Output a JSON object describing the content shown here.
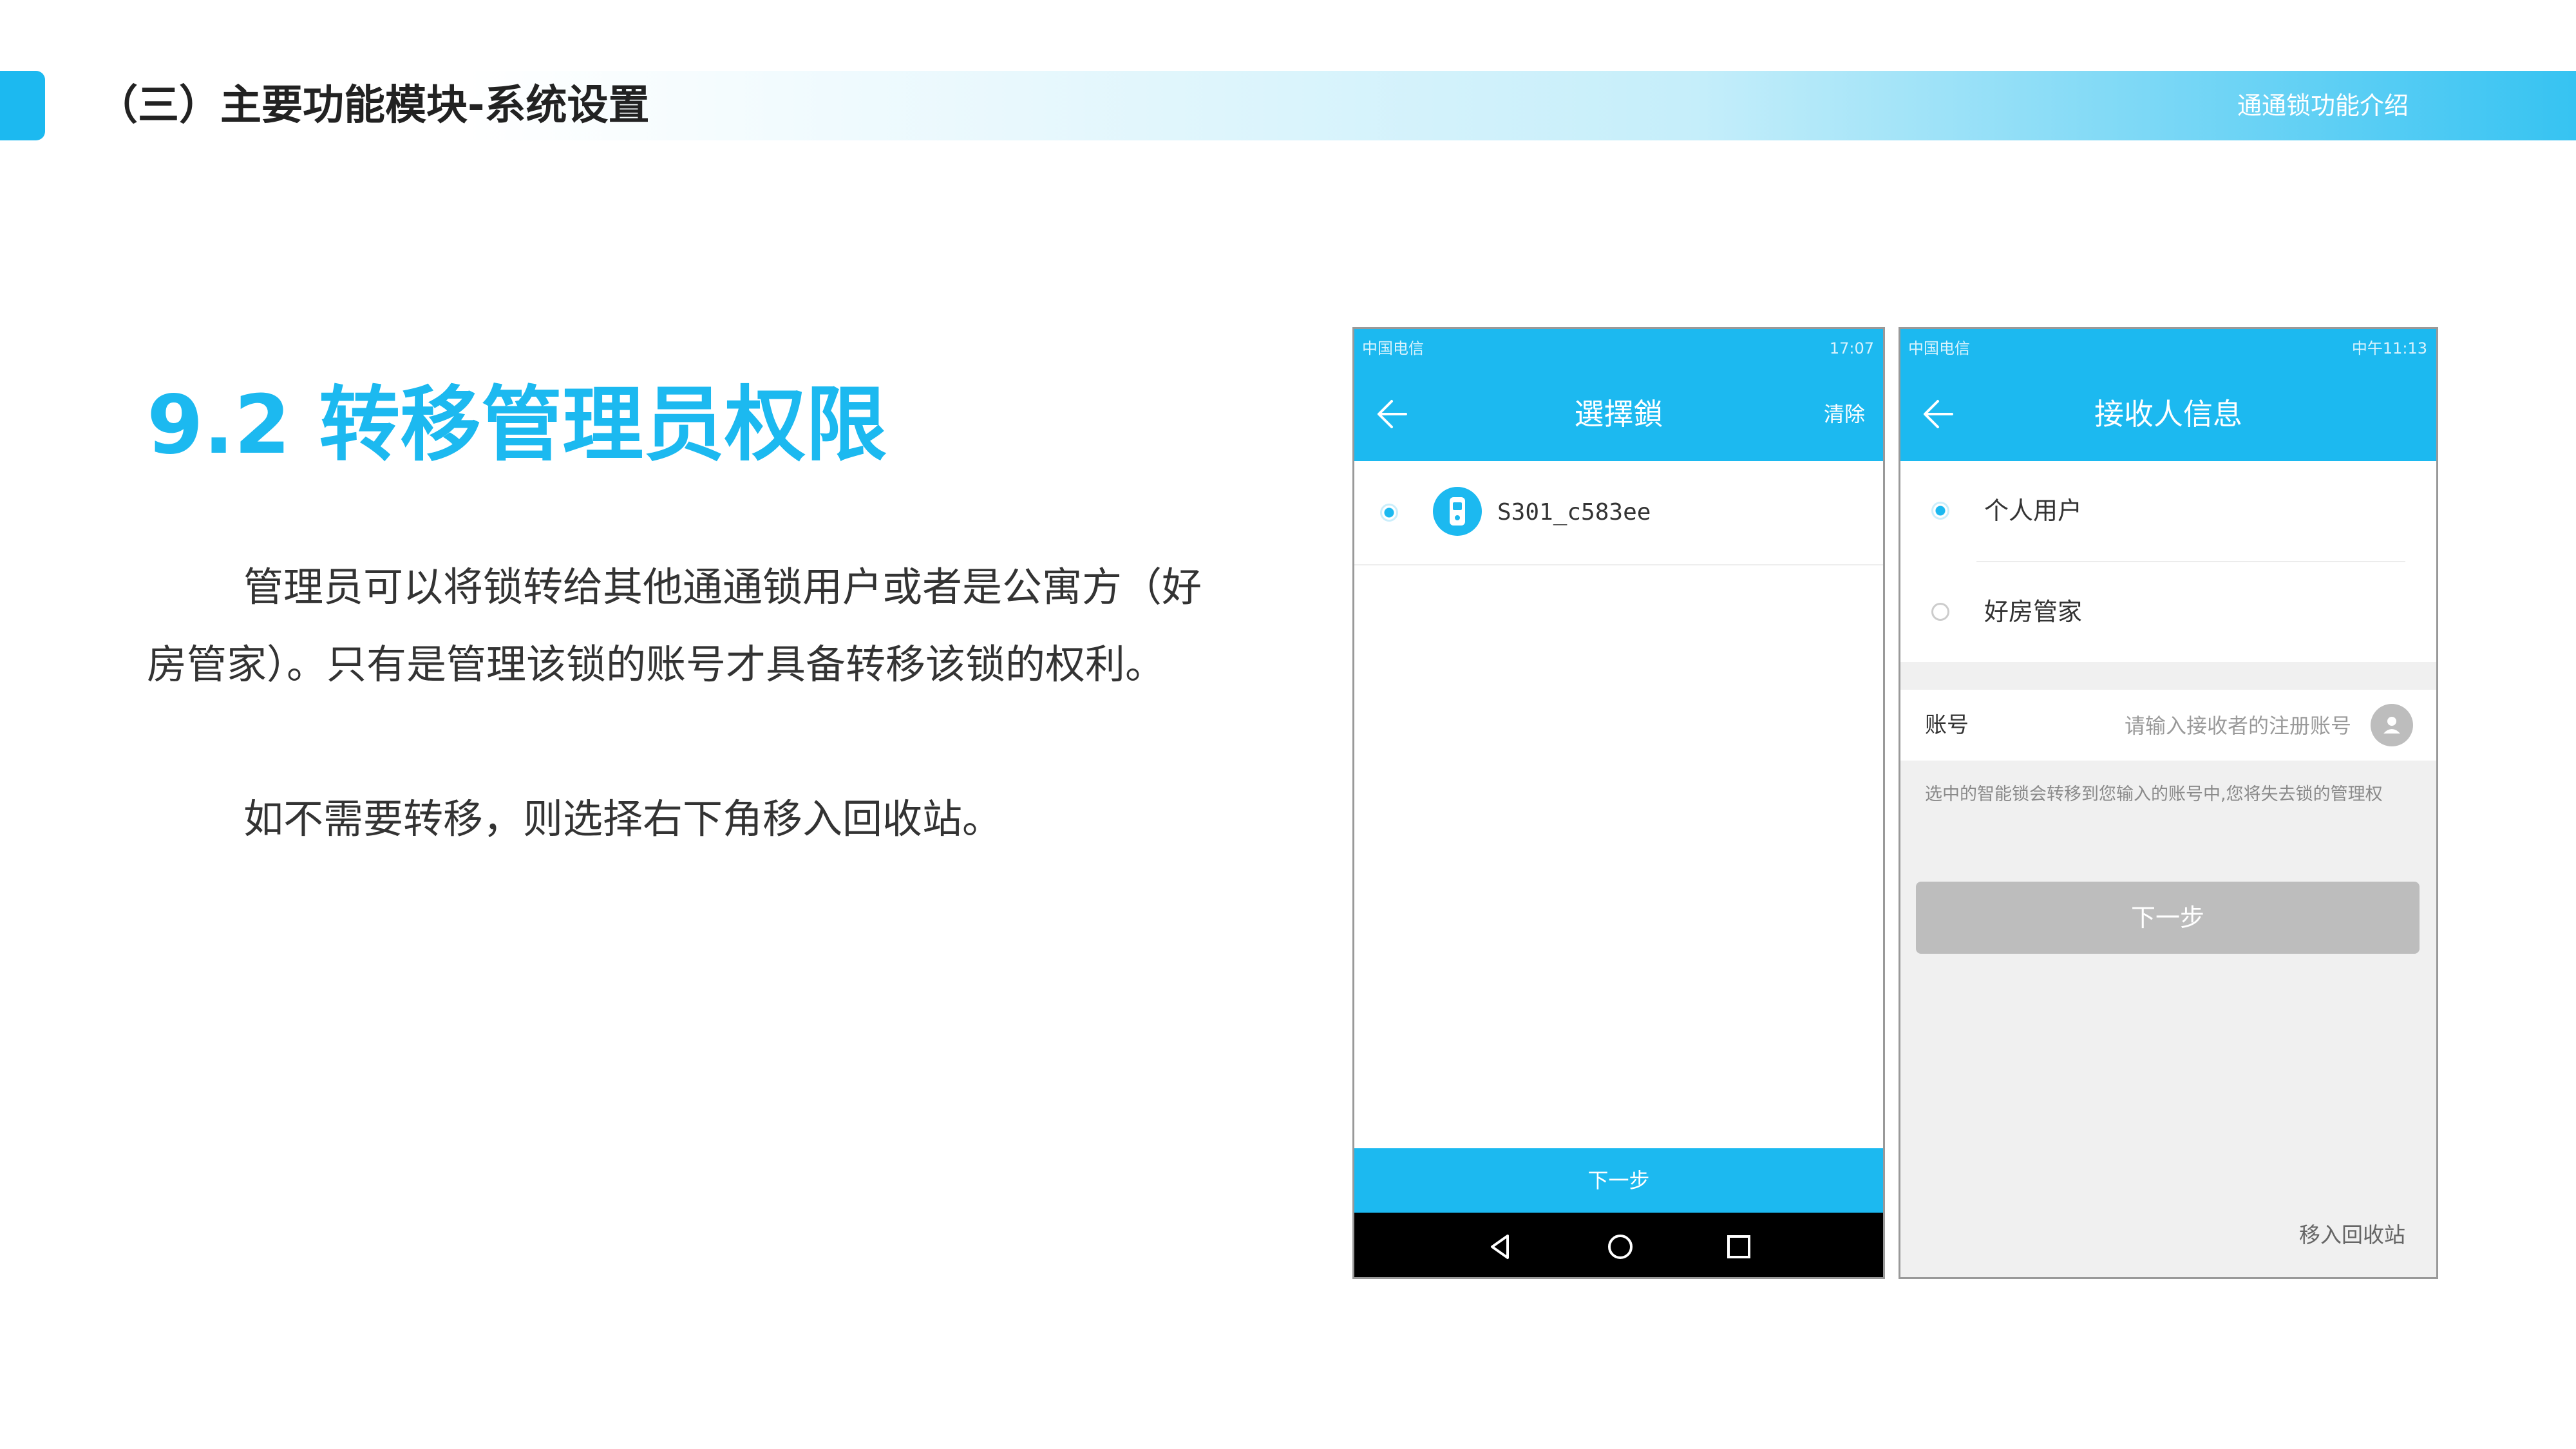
{
  "header": {
    "section_title": "（三）主要功能模块-系统设置",
    "right_label": "通通锁功能介绍"
  },
  "content": {
    "heading": "9.2 转移管理员权限",
    "paragraph1": "管理员可以将锁转给其他通通锁用户或者是公寓方（好房管家）。只有是管理该锁的账号才具备转移该锁的权利。",
    "paragraph2": "如不需要转移，则选择右下角移入回收站。"
  },
  "phone1": {
    "status_left": "中国电信",
    "status_time": "17:07",
    "title": "選擇鎖",
    "action": "清除",
    "lock_name": "S301_c583ee",
    "next_label": "下一步"
  },
  "phone2": {
    "status_left": "中国电信",
    "status_time": "中午11:13",
    "title": "接收人信息",
    "options": [
      {
        "label": "个人用户",
        "selected": true
      },
      {
        "label": "好房管家",
        "selected": false
      }
    ],
    "account_label": "账号",
    "account_placeholder": "请输入接收者的注册账号",
    "hint": "选中的智能锁会转移到您输入的账号中,您将失去锁的管理权",
    "next_label": "下一步",
    "recycle_label": "移入回收站"
  },
  "colors": {
    "accent": "#1cb9f0",
    "disabled_button": "#bdbdbd"
  },
  "icons": [
    "back-arrow-icon",
    "lock-device-icon",
    "radio-icon",
    "contact-icon",
    "nav-back-icon",
    "nav-home-icon",
    "nav-recent-icon"
  ]
}
